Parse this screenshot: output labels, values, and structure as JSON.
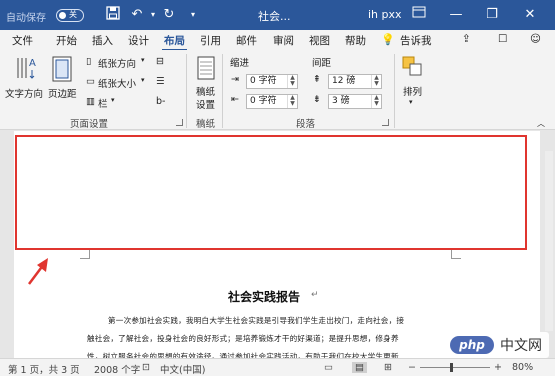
{
  "titlebar": {
    "autosave_label": "自动保存",
    "autosave_state": "关",
    "doc_title": "社会...",
    "user": "ih pxx",
    "minimize": "—",
    "restore": "❐",
    "close": "✕"
  },
  "menu": {
    "items": [
      "文件",
      "开始",
      "插入",
      "设计",
      "布局",
      "引用",
      "邮件",
      "审阅",
      "视图",
      "帮助"
    ],
    "active": "布局",
    "tell_me": "告诉我"
  },
  "ribbon": {
    "text_direction": "文字方向",
    "margins": "页边距",
    "orientation": "纸张方向",
    "size": "纸张大小",
    "columns": "栏",
    "group_page_setup": "页面设置",
    "draft_paper_line1": "稿纸",
    "draft_paper_line2": "设置",
    "group_draft": "稿纸",
    "indent_label": "缩进",
    "indent_left": "0 字符",
    "indent_right": "0 字符",
    "spacing_label": "间距",
    "spacing_before": "12 磅",
    "spacing_after": "3 磅",
    "group_paragraph": "段落",
    "arrange": "排列"
  },
  "document": {
    "title": "社会实践报告",
    "lines": [
      "第一次参加社会实践，我明白大学生社会实践是引导我们学生走出校门，走向社会，接",
      "触社会，了解社会，投身社会的良好形式；是培养锻炼才干的好渠道；是提升思想，修身养",
      "性，树立服务社会的思想的有效途径。通过参加社会实践活动，有助于我们在校大学生更新"
    ]
  },
  "status": {
    "page": "第 1 页，共 3 页",
    "words": "2008 个字",
    "language": "中文(中国)",
    "zoom": "80%"
  },
  "watermark": {
    "logo": "php",
    "text": "中文网"
  },
  "colors": {
    "brand": "#2b579a",
    "highlight": "#e0352f"
  }
}
